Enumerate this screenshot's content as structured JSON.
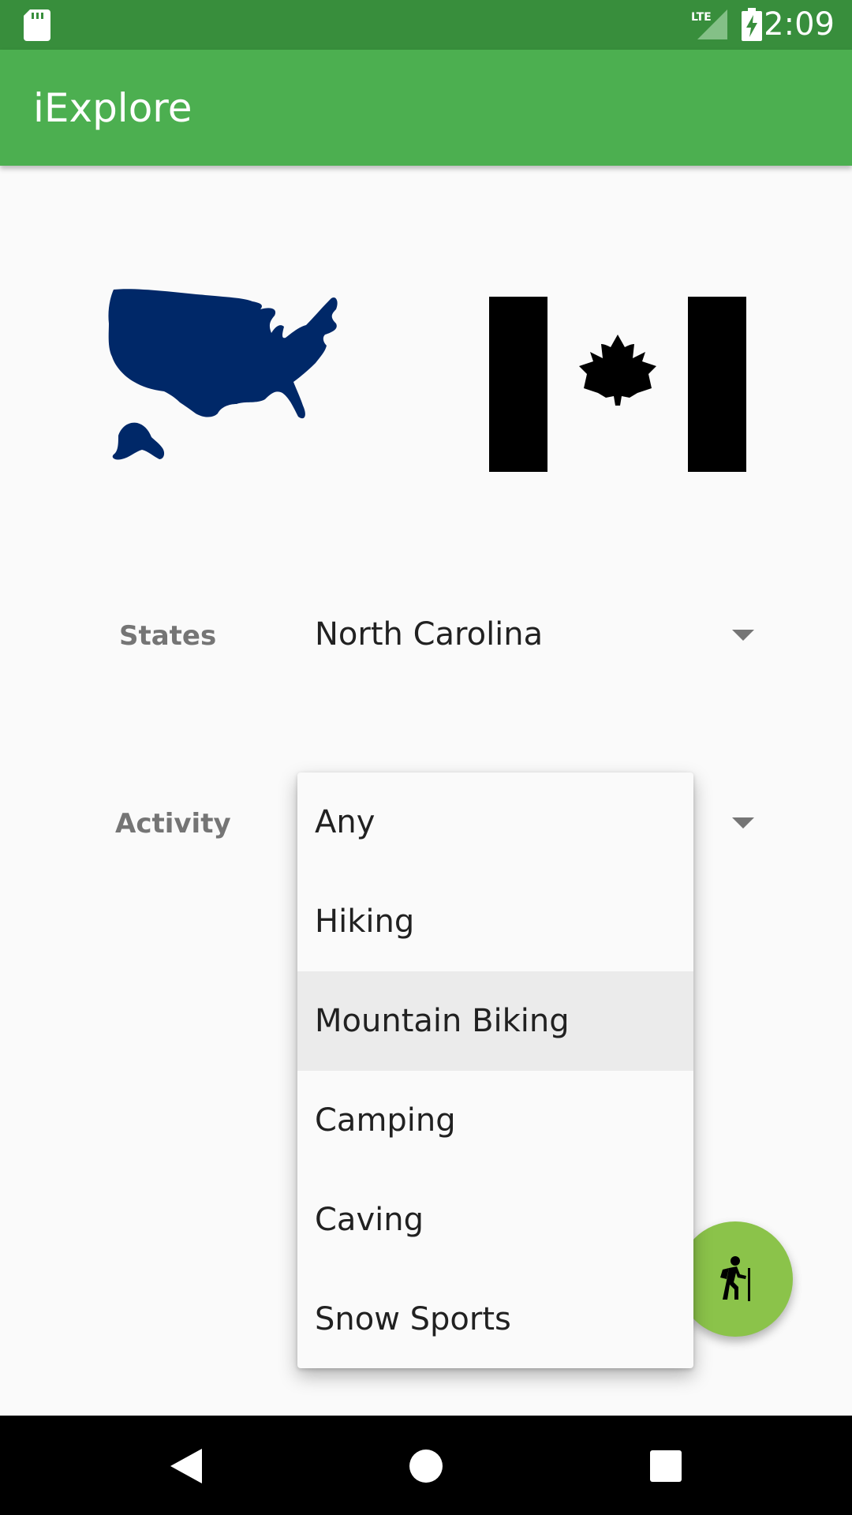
{
  "status_bar": {
    "time": "2:09",
    "network": "LTE",
    "icons": [
      "sd-card-icon",
      "lte-signal-icon",
      "battery-charging-icon"
    ]
  },
  "app_bar": {
    "title": "iExplore",
    "color": "#4caf50"
  },
  "images": [
    "usa-map-icon",
    "canada-flag-icon"
  ],
  "form": {
    "states_label": "States",
    "states_value": "North Carolina",
    "activity_label": "Activity"
  },
  "activity_dropdown": {
    "items": [
      "Any",
      "Hiking",
      "Mountain Biking",
      "Camping",
      "Caving",
      "Snow Sports"
    ],
    "highlighted": "Mountain Biking"
  },
  "fab": {
    "icon": "hiker-icon",
    "color": "#8bc34a"
  },
  "nav_bar": {
    "icons": [
      "back-icon",
      "home-icon",
      "recents-icon"
    ]
  }
}
